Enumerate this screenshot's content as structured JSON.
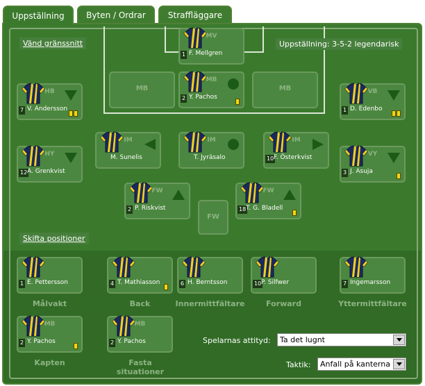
{
  "tabs": [
    {
      "label": "Uppställning",
      "active": true
    },
    {
      "label": "Byten / Ordrar",
      "active": false
    },
    {
      "label": "Straffläggare",
      "active": false
    }
  ],
  "links": {
    "flip": "Vänd gränssnitt",
    "shift": "Skifta positioner"
  },
  "formation": "Uppställning: 3-5-2 legendarisk",
  "slots": {
    "mv": {
      "pos": "MV",
      "num": "1",
      "name": "F. Mellgren",
      "card": "",
      "arrow": ""
    },
    "mb_left": {
      "pos": "MB"
    },
    "mb_center": {
      "pos": "MB",
      "num": "2",
      "name": "Y. Pachos",
      "card": "yellow",
      "arrow": "circle"
    },
    "mb_right": {
      "pos": "MB"
    },
    "hb": {
      "pos": "HB",
      "num": "7",
      "name": "V. Andersson",
      "card": "yellow2",
      "arrow": "down"
    },
    "vb": {
      "pos": "VB",
      "num": "1",
      "name": "D. Edenbo",
      "card": "yellow2",
      "arrow": "down"
    },
    "hy": {
      "pos": "HY",
      "num": "12",
      "name": "A. Grenkvist",
      "card": "",
      "arrow": "down"
    },
    "im_left": {
      "pos": "IM",
      "num": "",
      "name": "M. Sunelis",
      "card": "",
      "arrow": "left"
    },
    "im_center": {
      "pos": "IM",
      "num": "",
      "name": "T. Jyräsalo",
      "card": "",
      "arrow": "circle"
    },
    "im_right": {
      "pos": "IM",
      "num": "10",
      "name": "F. Österkvist",
      "card": "",
      "arrow": "right"
    },
    "vy": {
      "pos": "VY",
      "num": "3",
      "name": "J. Asuja",
      "card": "yellow",
      "arrow": "down"
    },
    "fw_left": {
      "pos": "FW",
      "num": "2",
      "name": "P. Riskvist",
      "card": "",
      "arrow": "up"
    },
    "fw_mid": {
      "pos": "FW"
    },
    "fw_right": {
      "pos": "FW",
      "num": "18",
      "name": "T. G. Bladell",
      "card": "yellow",
      "arrow": "up"
    }
  },
  "bench": [
    {
      "num": "1",
      "name": "E. Pettersson",
      "role": "Målvakt",
      "card": ""
    },
    {
      "num": "4",
      "name": "T. Mathiasson",
      "role": "Back",
      "card": "yellow"
    },
    {
      "num": "6",
      "name": "H. Berntsson",
      "role": "Innermittfältare",
      "card": ""
    },
    {
      "num": "10",
      "name": "P. Silfwer",
      "role": "Forward",
      "card": ""
    },
    {
      "num": "7",
      "name": "Ingemarsson",
      "role": "Yttermittfältare",
      "card": ""
    }
  ],
  "special": [
    {
      "pos": "MB",
      "num": "2",
      "name": "Y. Pachos",
      "role": "Kapten",
      "card": "yellow"
    },
    {
      "pos": "MB",
      "num": "2",
      "name": "Y. Pachos",
      "role": "Fasta situationer",
      "card": ""
    }
  ],
  "attitude": {
    "label": "Spelarnas attityd:",
    "value": "Ta det lugnt"
  },
  "tactic": {
    "label": "Taktik:",
    "value": "Anfall på kanterna"
  }
}
